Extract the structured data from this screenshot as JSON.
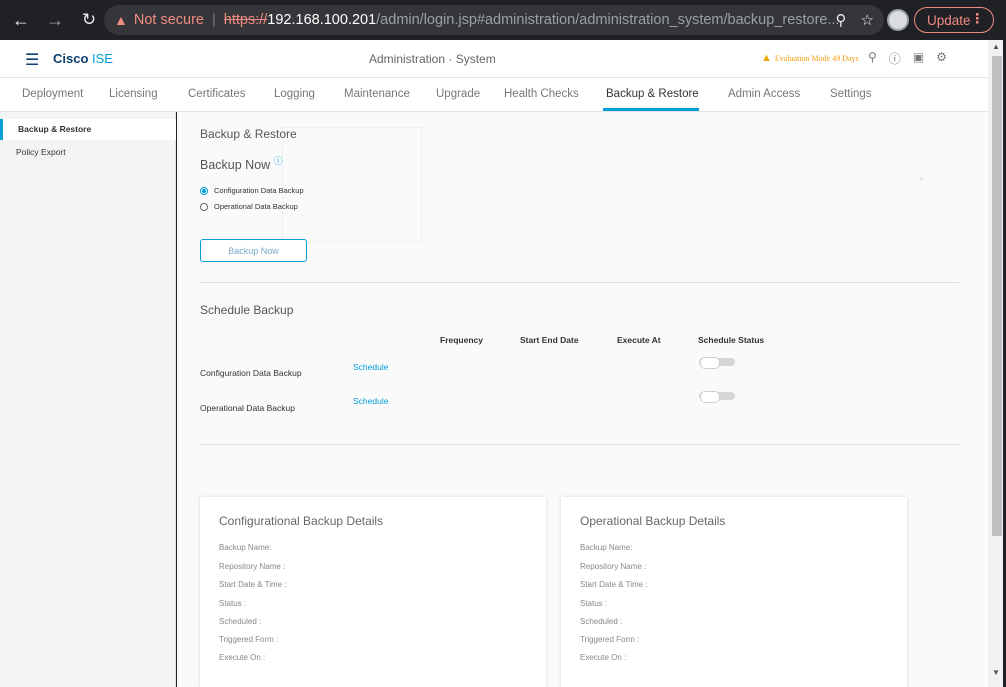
{
  "browser": {
    "not_secure": "Not secure",
    "url_scheme": "https://",
    "url_host": "192.168.100.201",
    "url_path": "/admin/login.jsp#administration/administration_system/backup_restore...",
    "update_label": "Update",
    "icons": [
      "back-arrow-icon",
      "forward-arrow-icon",
      "reload-icon",
      "zoom-icon",
      "star-icon",
      "profile-avatar",
      "kebab-menu-icon"
    ]
  },
  "header": {
    "brand_bold": "Cisco",
    "brand_light": " ISE",
    "page_title": "Administration · System",
    "eval_text": "Evaluation Mode 49 Days",
    "icons": [
      "search-icon",
      "help-icon",
      "dashboard-icon",
      "gear-icon"
    ]
  },
  "tabs": [
    {
      "label": "Deployment"
    },
    {
      "label": "Licensing"
    },
    {
      "label": "Certificates"
    },
    {
      "label": "Logging"
    },
    {
      "label": "Maintenance"
    },
    {
      "label": "Upgrade"
    },
    {
      "label": "Health Checks"
    },
    {
      "label": "Backup & Restore",
      "active": true
    },
    {
      "label": "Admin Access"
    },
    {
      "label": "Settings"
    }
  ],
  "leftnav": {
    "items": [
      {
        "label": "Backup & Restore",
        "active": true
      },
      {
        "label": "Policy Export"
      }
    ]
  },
  "main": {
    "section_title": "Backup & Restore",
    "backup_now_title": "Backup Now",
    "radio_config": "Configuration Data Backup",
    "radio_operational": "Operational Data Backup",
    "backup_now_button": "Backup Now",
    "schedule_title": "Schedule Backup",
    "columns": {
      "frequency": "Frequency",
      "start_end_date": "Start End Date",
      "execute_at": "Execute At",
      "schedule_status": "Schedule Status"
    },
    "rows": [
      {
        "label": "Configuration Data Backup",
        "link": "Schedule"
      },
      {
        "label": "Operational Data Backup",
        "link": "Schedule"
      }
    ],
    "config_card": {
      "title": "Configurational Backup Details",
      "fields": [
        "Backup Name:",
        "Repository Name :",
        "Start Date & Time :",
        "Status :",
        "Scheduled :",
        "Triggered Form :",
        "Execute On :"
      ]
    },
    "operational_card": {
      "title": "Operational Backup Details",
      "fields": [
        "Backup Name:",
        "Repository Name :",
        "Start Date & Time :",
        "Status :",
        "Scheduled :",
        "Triggered Form :",
        "Execute On :"
      ]
    }
  }
}
